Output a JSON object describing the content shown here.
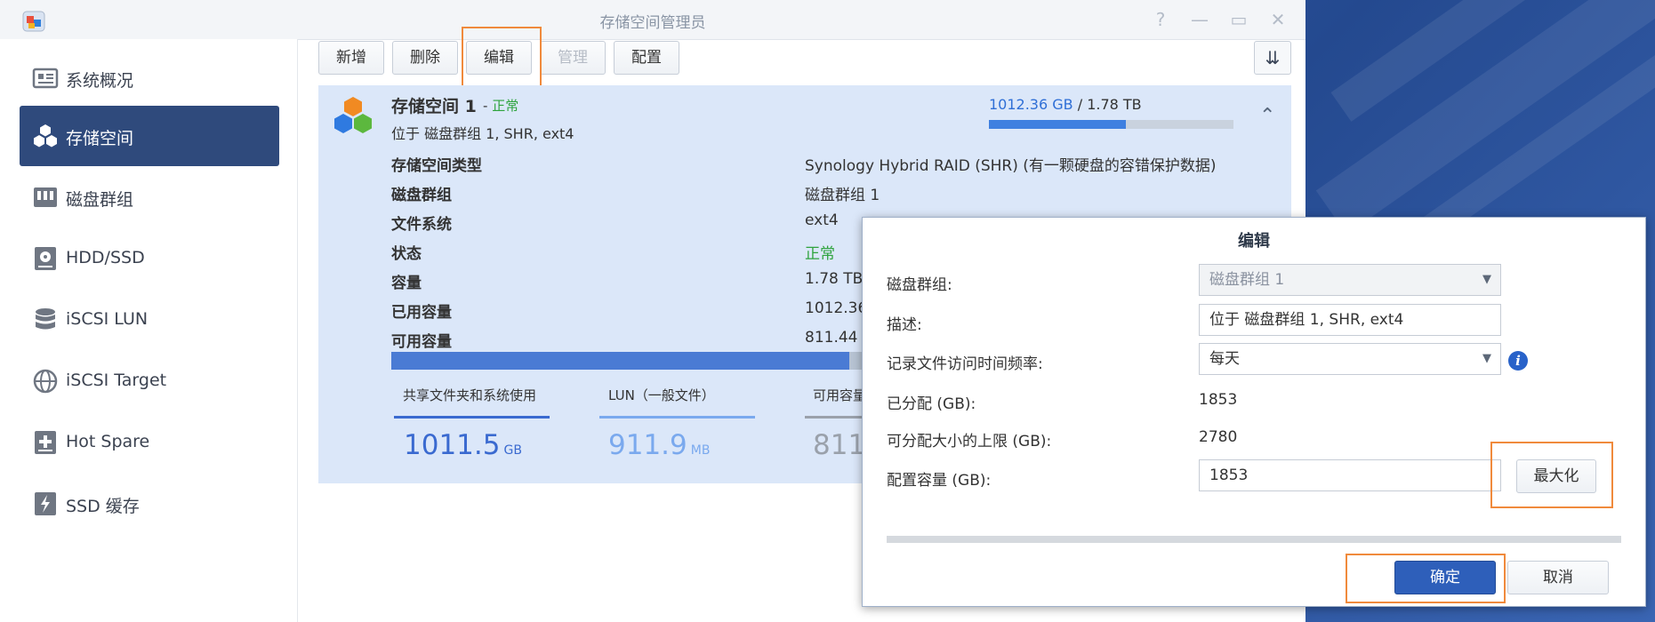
{
  "window": {
    "title": "存储空间管理员"
  },
  "titlebar_buttons": {
    "help": "?",
    "minimize": "—",
    "maximize": "▭",
    "close": "✕"
  },
  "sidebar": {
    "items": [
      {
        "label": "系统概况",
        "icon": "overview-icon",
        "active": false
      },
      {
        "label": "存储空间",
        "icon": "storage-cubes-icon",
        "active": true
      },
      {
        "label": "磁盘群组",
        "icon": "disk-group-icon",
        "active": false
      },
      {
        "label": "HDD/SSD",
        "icon": "hdd-icon",
        "active": false
      },
      {
        "label": "iSCSI LUN",
        "icon": "database-icon",
        "active": false
      },
      {
        "label": "iSCSI Target",
        "icon": "globe-icon",
        "active": false
      },
      {
        "label": "Hot Spare",
        "icon": "hot-spare-icon",
        "active": false
      },
      {
        "label": "SSD 缓存",
        "icon": "ssd-cache-icon",
        "active": false
      }
    ]
  },
  "toolbar": {
    "create": "新增",
    "delete": "删除",
    "edit": "编辑",
    "manage": "管理",
    "configure": "配置",
    "sort_icon": "⇊"
  },
  "volume": {
    "title": "存储空间 1",
    "status_sep": "-",
    "status": "正常",
    "subtitle": "位于 磁盘群组 1, SHR, ext4",
    "used_capacity": "1012.36 GB",
    "total_capacity": "/ 1.78 TB",
    "used_fraction": 0.56,
    "collapse_icon": "⌃",
    "details": [
      {
        "key": "存储空间类型",
        "value": "Synology Hybrid RAID (SHR) (有一颗硬盘的容错保护数据)"
      },
      {
        "key": "磁盘群组",
        "value": "磁盘群组 1"
      },
      {
        "key": "文件系统",
        "value": "ext4"
      },
      {
        "key": "状态",
        "value": "正常"
      },
      {
        "key": "容量",
        "value": "1.78 TB"
      },
      {
        "key": "已用容量",
        "value": "1012.36"
      },
      {
        "key": "可用容量",
        "value": "811.44"
      }
    ],
    "usage": [
      {
        "label": "共享文件夹和系统使用",
        "value": "1011.5",
        "unit": "GB",
        "color": "#3a6ad0"
      },
      {
        "label": "LUN（一般文件）",
        "value": "911.9",
        "unit": "MB",
        "color": "#7aa9ee"
      },
      {
        "label": "可用容量",
        "value": "811",
        "unit": "",
        "color": "#9aa1ab"
      }
    ]
  },
  "dialog": {
    "title": "编辑",
    "disk_group_label": "磁盘群组:",
    "disk_group_value": "磁盘群组 1",
    "description_label": "描述:",
    "description_value": "位于 磁盘群组 1, SHR, ext4",
    "atime_label": "记录文件访问时间频率:",
    "atime_value": "每天",
    "allocated_label": "已分配 (GB):",
    "allocated_value": "1853",
    "max_label": "可分配大小的上限 (GB):",
    "max_value": "2780",
    "config_label": "配置容量 (GB):",
    "config_value": "1853",
    "maximize_button": "最大化",
    "ok_button": "确定",
    "cancel_button": "取消",
    "info_icon": "i"
  }
}
